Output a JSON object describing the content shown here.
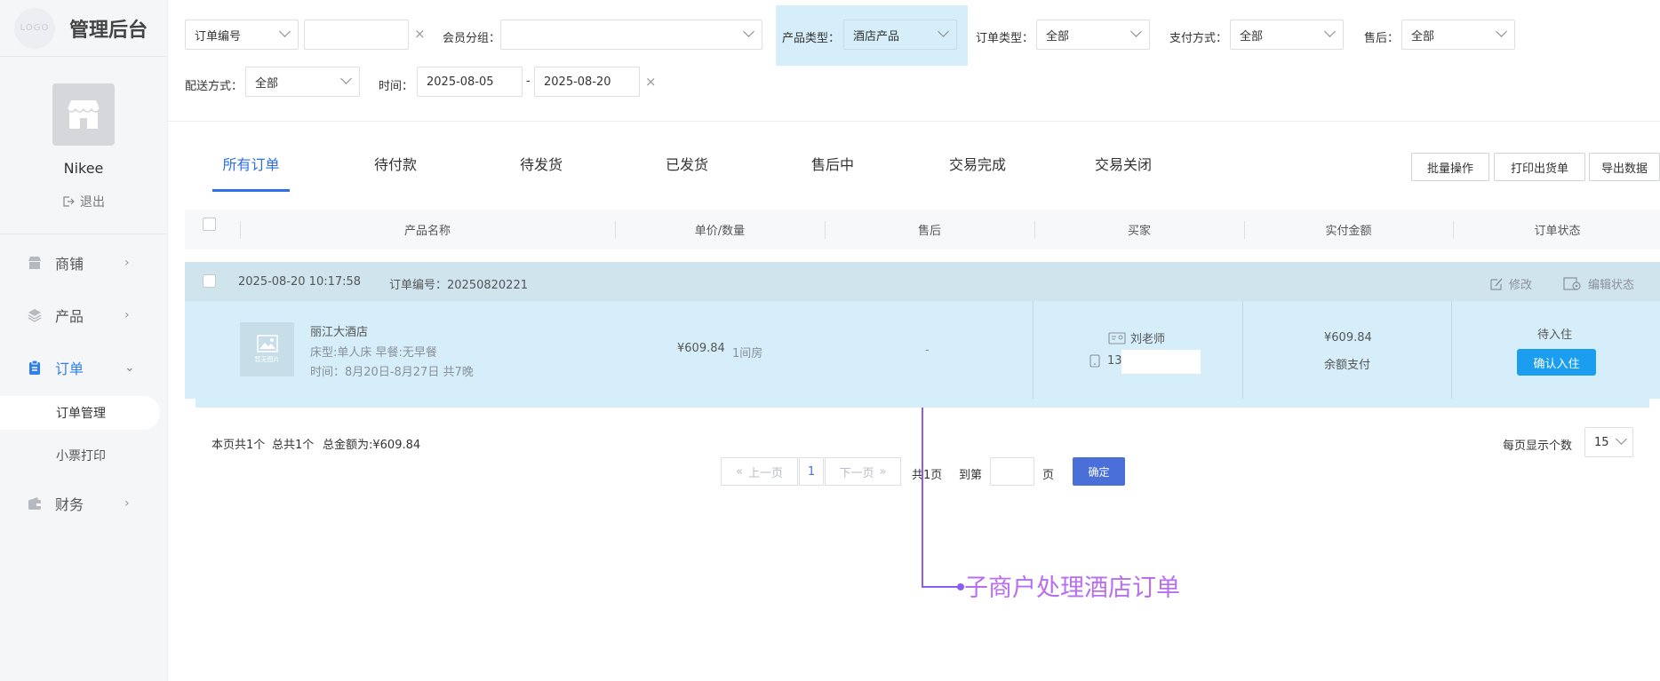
{
  "sidebar": {
    "logo_text": "LOGO",
    "brand_title": "管理后台",
    "username": "Nikee",
    "logout": "退出",
    "nav": [
      {
        "label": "商铺",
        "icon": "store-icon"
      },
      {
        "label": "产品",
        "icon": "layers-icon"
      },
      {
        "label": "订单",
        "icon": "clipboard-icon"
      },
      {
        "label": "财务",
        "icon": "wallet-icon"
      }
    ],
    "sub_items": [
      "订单管理",
      "小票打印"
    ]
  },
  "filters": {
    "order_field_select": "订单编号",
    "order_field_value": "",
    "member_group_label": "会员分组：",
    "member_group_value": "",
    "product_type_label": "产品类型：",
    "product_type_value": "酒店产品",
    "order_type_label": "订单类型：",
    "order_type_value": "全部",
    "pay_method_label": "支付方式：",
    "pay_method_value": "全部",
    "after_sale_label": "售后：",
    "after_sale_value": "全部",
    "delivery_label": "配送方式：",
    "delivery_value": "全部",
    "time_label": "时间：",
    "date_from": "2025-08-05",
    "date_sep": "-",
    "date_to": "2025-08-20",
    "clear": "×"
  },
  "tabs": [
    "所有订单",
    "待付款",
    "待发货",
    "已发货",
    "售后中",
    "交易完成",
    "交易关闭"
  ],
  "actions": {
    "batch": "批量操作",
    "print": "打印出货单",
    "export": "导出数据"
  },
  "table": {
    "columns": [
      "产品名称",
      "单价/数量",
      "售后",
      "买家",
      "实付金额",
      "订单状态"
    ]
  },
  "order": {
    "datetime": "2025-08-20 10:17:58",
    "order_no": "订单编号：20250820221",
    "edit": "修改",
    "edit_status": "编辑状态",
    "thumb_text": "暂无图片",
    "product_name": "丽江大酒店",
    "spec": "床型:单人床 早餐:无早餐",
    "period": "时间：8月20日-8月27日 共7晚",
    "price": "¥609.84",
    "qty": "1间房",
    "after_sale": "-",
    "buyer_name": "刘老师",
    "buyer_phone": "13",
    "paid": "¥609.84",
    "pay_method": "余额支付",
    "status": "待入住",
    "confirm_btn": "确认入住"
  },
  "summary": {
    "page_count": "本页共1个",
    "total_count": "总共1个",
    "total_amount": "总金额为:¥609.84"
  },
  "pagination": {
    "prev": "上一页",
    "current": "1",
    "next": "下一页",
    "total_pages": "共1页",
    "goto": "到第",
    "page_unit": "页",
    "confirm": "确定",
    "per_page_label": "每页显示个数",
    "per_page": "15"
  },
  "annotation": "子商户处理酒店订单"
}
